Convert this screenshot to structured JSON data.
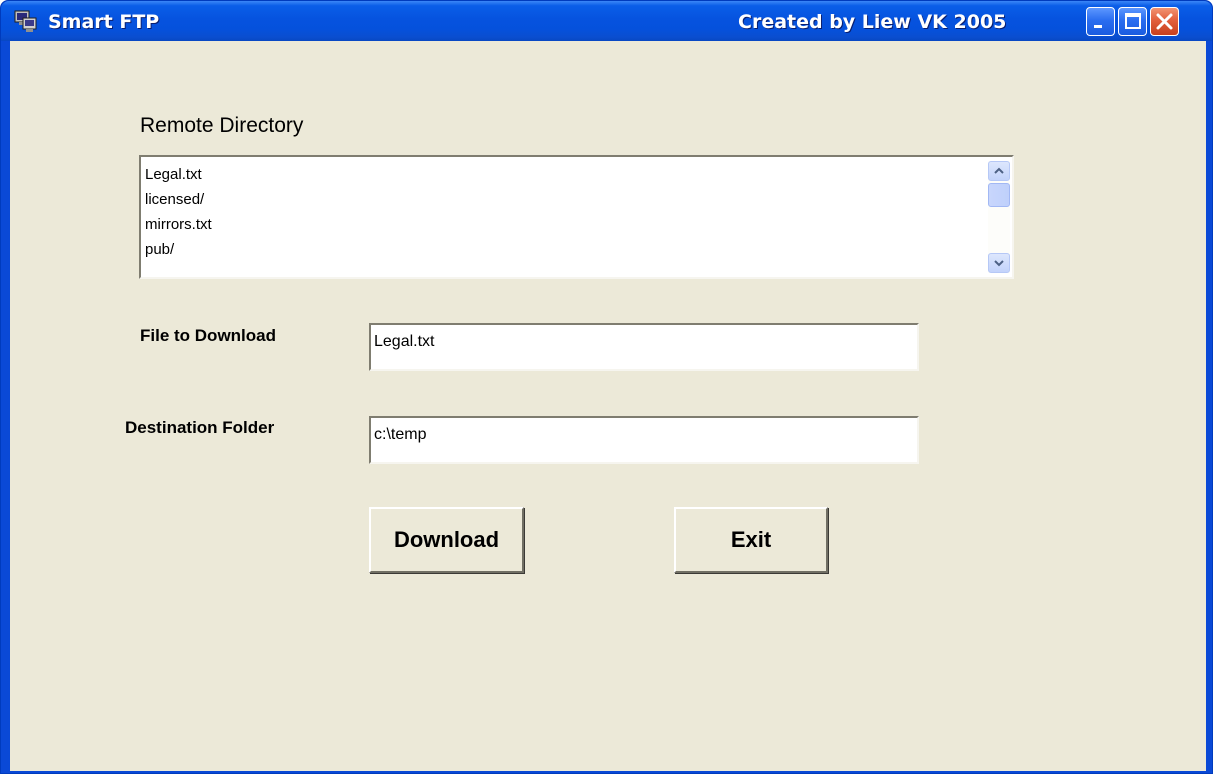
{
  "window": {
    "title": "Smart FTP",
    "credit": "Created by Liew VK 2005"
  },
  "remote_directory": {
    "label": "Remote Directory",
    "items": [
      "Legal.txt",
      "licensed/",
      "mirrors.txt",
      "pub/"
    ]
  },
  "file_to_download": {
    "label": "File to Download",
    "value": "Legal.txt"
  },
  "destination_folder": {
    "label": "Destination Folder",
    "value": "c:\\temp"
  },
  "buttons": {
    "download": "Download",
    "exit": "Exit"
  },
  "colors": {
    "titlebar": "#0553dd",
    "client_background": "#ece9d8",
    "close_button": "#e25f3c"
  },
  "icons": {
    "app": "ftp-computer-icon",
    "minimize": "minimize-icon",
    "maximize": "maximize-icon",
    "close": "close-icon",
    "scroll_up": "chevron-up-icon",
    "scroll_down": "chevron-down-icon"
  }
}
